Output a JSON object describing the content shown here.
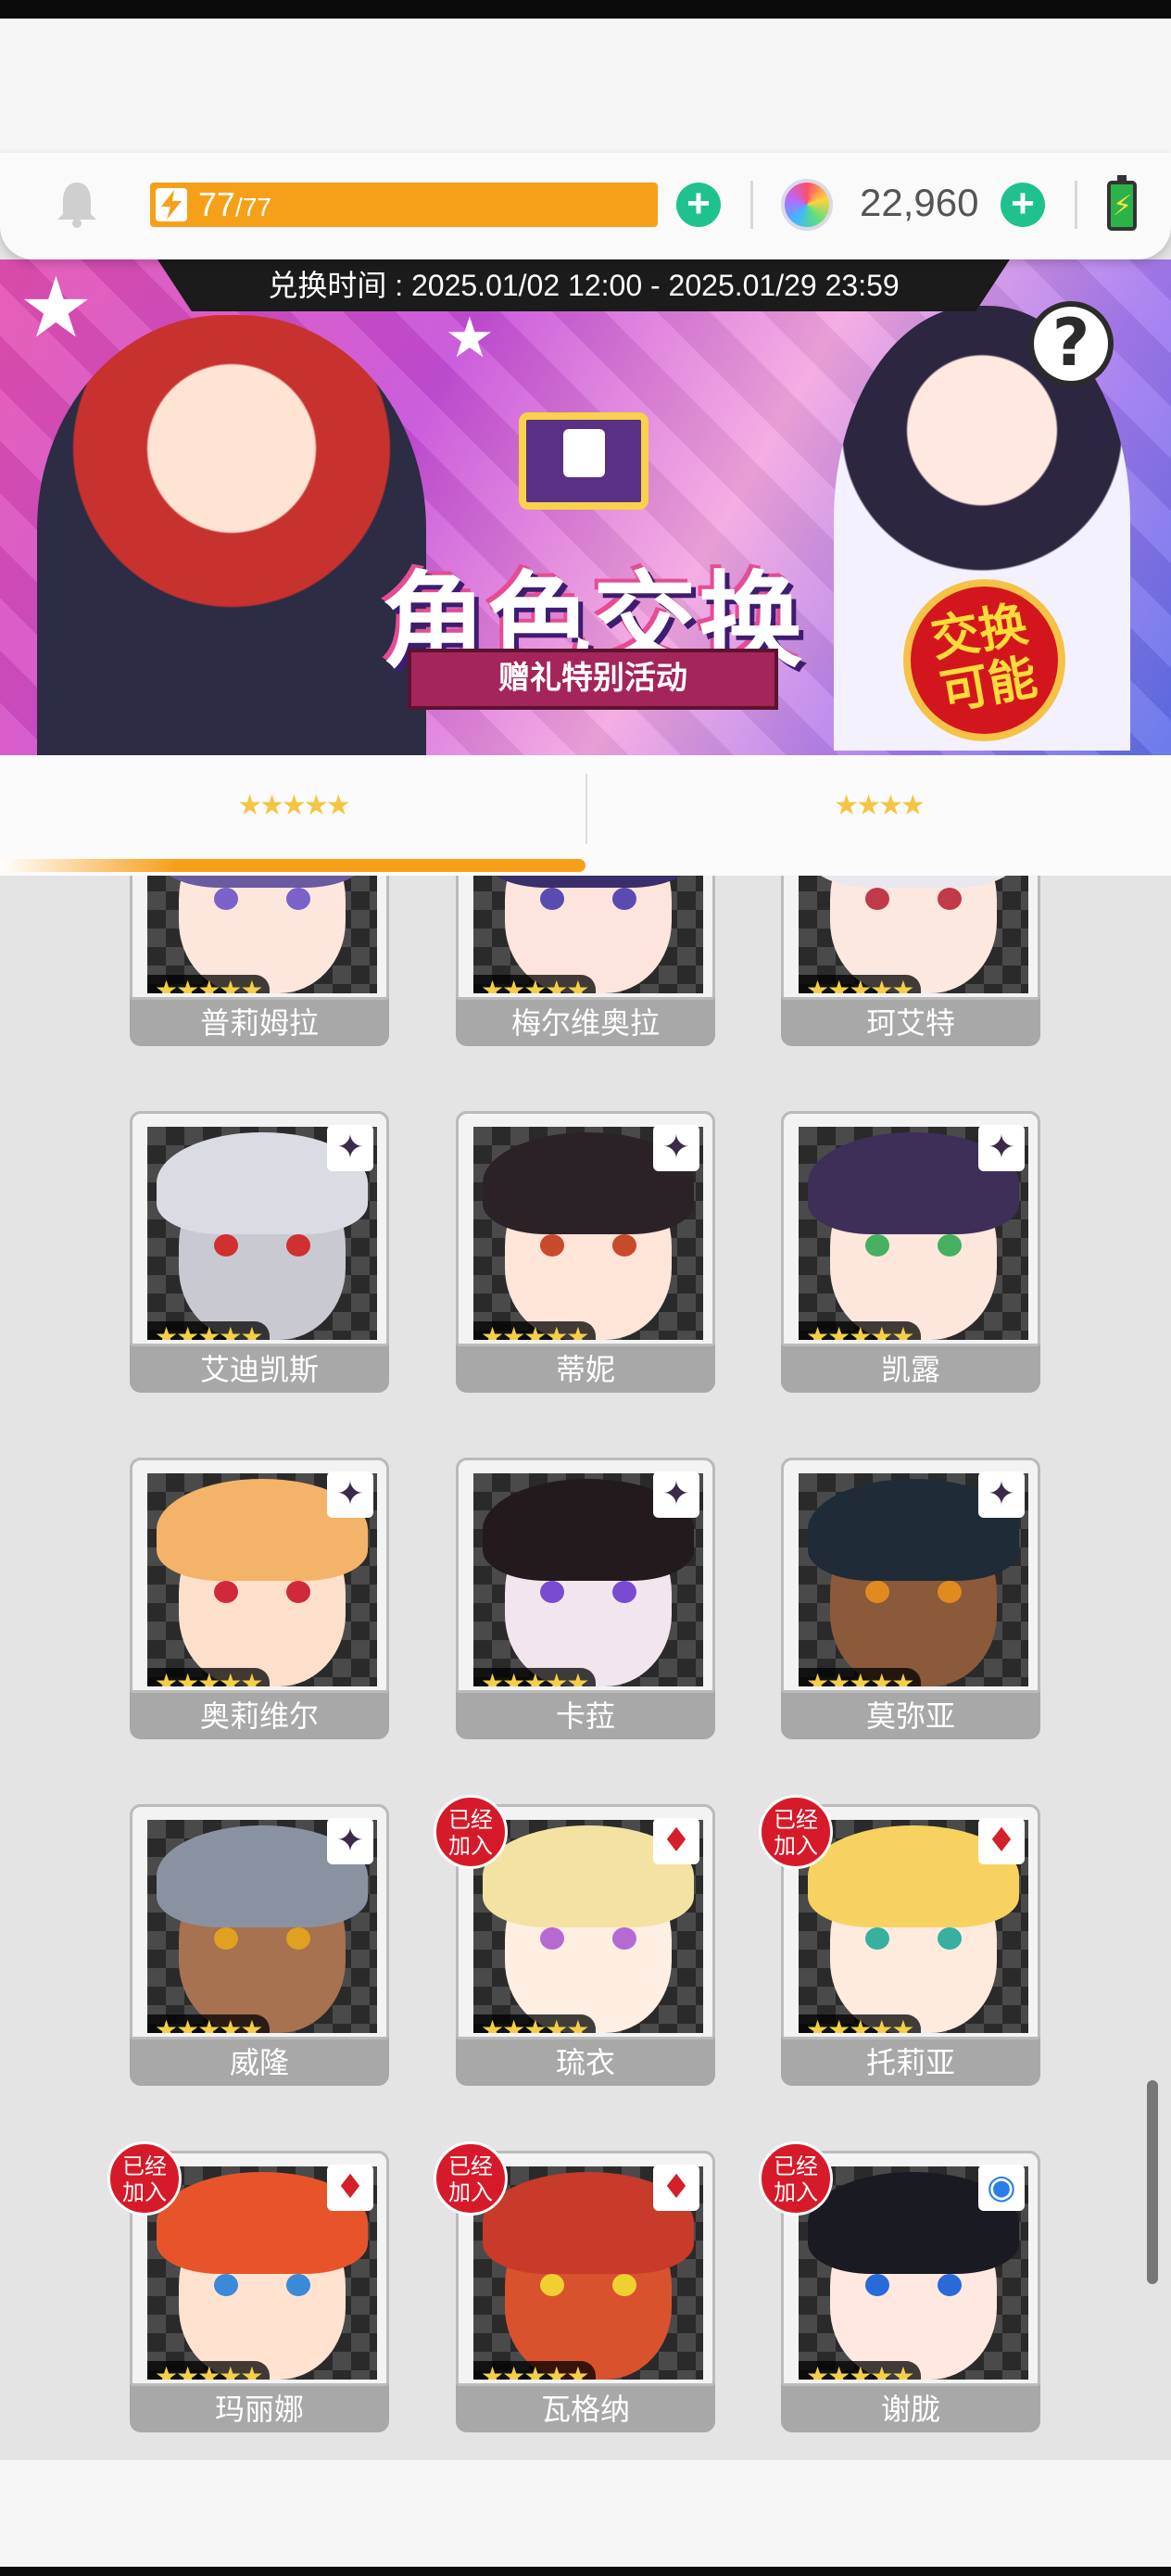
{
  "resources": {
    "energy_current": "77",
    "energy_max": "/77",
    "gem_count": "22,960"
  },
  "banner": {
    "time_text": "兑换时间 : 2025.01/02 12:00 - 2025.01/29 23:59",
    "title": "角色交换",
    "subtitle": "赠礼特别活动",
    "badge_line1": "交换",
    "badge_line2": "可能",
    "help_label": "?"
  },
  "tabs": [
    {
      "label": "★★★★★"
    },
    {
      "label": "★★★★"
    }
  ],
  "joined_label_line1": "已经",
  "joined_label_line2": "加入",
  "rating_stars": "★★★★★",
  "characters": [
    {
      "name": "普莉姆拉",
      "attr": "dark"
    },
    {
      "name": "梅尔维奥拉",
      "attr": "dark"
    },
    {
      "name": "珂艾特",
      "attr": "dark"
    },
    {
      "name": "艾迪凯斯",
      "attr": "dark"
    },
    {
      "name": "蒂妮",
      "attr": "dark"
    },
    {
      "name": "凯露",
      "attr": "dark"
    },
    {
      "name": "奥莉维尔",
      "attr": "dark"
    },
    {
      "name": "卡菈",
      "attr": "dark"
    },
    {
      "name": "莫弥亚",
      "attr": "dark"
    },
    {
      "name": "威隆",
      "attr": "dark"
    },
    {
      "name": "琉衣",
      "attr": "red"
    },
    {
      "name": "托莉亚",
      "attr": "red"
    },
    {
      "name": "玛丽娜",
      "attr": "red"
    },
    {
      "name": "瓦格纳",
      "attr": "red"
    },
    {
      "name": "谢胧",
      "attr": "blue"
    }
  ],
  "icons": {
    "bell": "bell-icon",
    "energy": "lightning-icon",
    "gem": "rainbow-gem-icon",
    "battery": "battery-icon",
    "attr_dark": "dark-element-icon",
    "attr_red": "fire-element-icon",
    "attr_blue": "water-element-icon",
    "attr_gold": "light-element-icon"
  },
  "colors": {
    "accent_orange": "#f6a019",
    "plus_green": "#1fc28e",
    "joined_red": "#d71a2a"
  }
}
